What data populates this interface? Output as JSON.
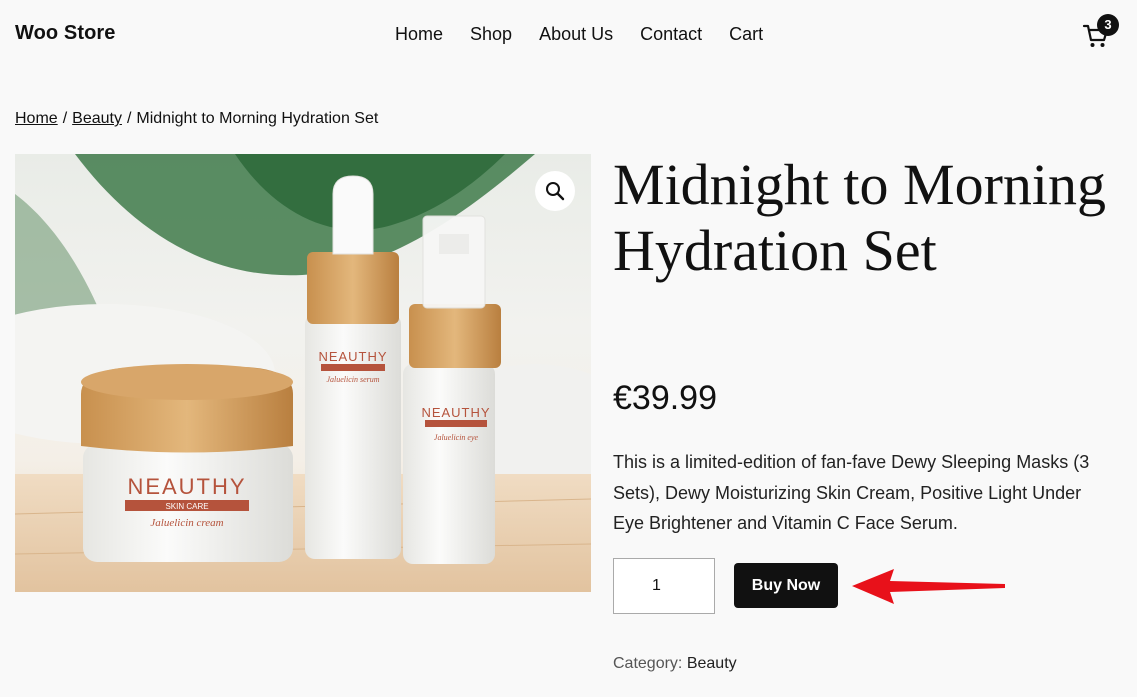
{
  "header": {
    "site_title": "Woo Store",
    "nav": [
      "Home",
      "Shop",
      "About Us",
      "Contact",
      "Cart"
    ],
    "cart_count": "3"
  },
  "breadcrumb": {
    "items": [
      "Home",
      "Beauty"
    ],
    "separator": "/",
    "current": "Midnight to Morning Hydration Set"
  },
  "product": {
    "title": "Midnight to Morning Hydration Set",
    "price": "€39.99",
    "description": "This is a limited-edition of fan-fave Dewy Sleeping Masks (3 Sets), Dewy Moisturizing Skin Cream, Positive Light Under Eye Brightener and Vitamin C Face Serum.",
    "quantity": "1",
    "buy_label": "Buy Now",
    "category_label": "Category:",
    "category": "Beauty",
    "image_labels": {
      "brand": "NEAUTHY",
      "sub": "SKIN CARE",
      "jar": "Jaluelicin cream",
      "serum": "Jaluelicin serum",
      "eye": "Jaluelicin eye"
    }
  },
  "colors": {
    "accent": "#111111",
    "background": "#f9f9f9",
    "arrow": "#e8111a",
    "label_terracotta": "#b5533c"
  }
}
